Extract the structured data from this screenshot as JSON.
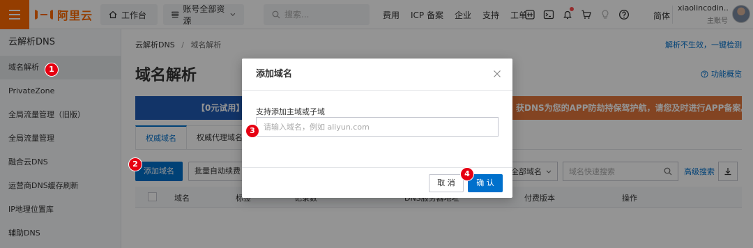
{
  "topbar": {
    "logo_text": "阿里云",
    "workbench_label": "工作台",
    "resources_label": "账号全部资源",
    "search_placeholder": "搜索...",
    "nav_links": [
      "费用",
      "ICP 备案",
      "企业",
      "支持",
      "工单"
    ],
    "language": "简体",
    "account_name": "xiaolincodin...",
    "account_role": "主账号"
  },
  "sidebar": {
    "title": "云解析DNS",
    "items": [
      {
        "label": "域名解析",
        "active": true
      },
      {
        "label": "PrivateZone"
      },
      {
        "label": "全局流量管理（旧版）"
      },
      {
        "label": "全局流量管理"
      },
      {
        "label": "融合云DNS"
      },
      {
        "label": "运营商DNS缓存刷新"
      },
      {
        "label": "IP地理位置库"
      },
      {
        "label": "辅助DNS"
      }
    ]
  },
  "main": {
    "breadcrumb": [
      "云解析DNS",
      "域名解析"
    ],
    "top_right_link": "解析不生效，一键检测",
    "page_title": "域名解析",
    "overview_link": "功能概览",
    "banner_left": "【0元试用】",
    "banner_right": "获DNS为您的APP防劫持保驾护航，请您及时进行APP备案。",
    "tabs": [
      "权威域名",
      "权威代理域名"
    ],
    "add_domain_button": "添加域名",
    "batch_button": "批量自动续费",
    "filter_select": "全部域名",
    "quick_search_placeholder": "域名快速搜索",
    "advanced_search": "高级搜索",
    "table_headers": [
      "域名",
      "标签",
      "记录数",
      "DNS服务器地址",
      "付费版本",
      "操作"
    ]
  },
  "modal": {
    "title": "添加域名",
    "field_label": "支持添加主域或子域",
    "input_placeholder": "请输入域名，例如 aliyun.com",
    "cancel_label": "取 消",
    "confirm_label": "确 认"
  },
  "markers": [
    "1",
    "2",
    "3",
    "4"
  ],
  "colors": {
    "brand": "#ff6a00",
    "primary": "#0070cc",
    "marker": "#e60012",
    "banner_blue": "#1f5ab4",
    "banner_orange": "#e2763b"
  }
}
